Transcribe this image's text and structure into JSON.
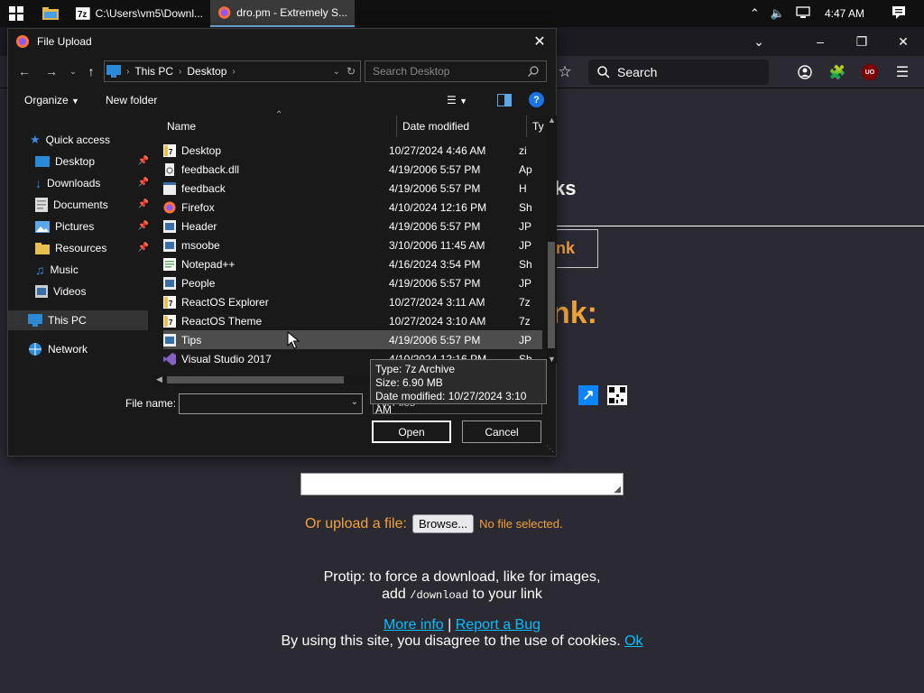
{
  "taskbar": {
    "tasks": [
      {
        "label": "C:\\Users\\vm5\\Downl...",
        "icon": "7zip-icon"
      },
      {
        "label": "dro.pm - Extremely S...",
        "icon": "firefox-icon"
      }
    ],
    "clock": "4:47 AM"
  },
  "firefox": {
    "search_placeholder": "Search",
    "ublock_badge": "UO"
  },
  "page": {
    "heading_frag_1": "ks",
    "heading_frag_2": "nk:",
    "link_box_text": "nk",
    "upload_label": "Or upload a file:",
    "browse_button": "Browse...",
    "no_file": "No file selected.",
    "protip_line1": "Protip: to force a download, like for images,",
    "protip_line2_pre": "add",
    "protip_code": "/download",
    "protip_line2_post": "to your link",
    "more_info": "More info",
    "separator": "|",
    "report_bug": "Report a Bug",
    "cookie_text": "By using this site, you disagree to the use of cookies.",
    "cookie_ok": "Ok"
  },
  "dialog": {
    "title": "File Upload",
    "breadcrumb": [
      "This PC",
      "Desktop"
    ],
    "search_placeholder": "Search Desktop",
    "organize": "Organize",
    "new_folder": "New folder",
    "nav": {
      "quick_access": "Quick access",
      "items": [
        {
          "label": "Desktop",
          "pinned": true
        },
        {
          "label": "Downloads",
          "pinned": true
        },
        {
          "label": "Documents",
          "pinned": true
        },
        {
          "label": "Pictures",
          "pinned": true
        },
        {
          "label": "Resources",
          "pinned": true
        },
        {
          "label": "Music",
          "pinned": false
        },
        {
          "label": "Videos",
          "pinned": false
        }
      ],
      "this_pc": "This PC",
      "network": "Network"
    },
    "columns": {
      "name": "Name",
      "date": "Date modified",
      "type": "Ty"
    },
    "files": [
      {
        "name": "Desktop",
        "date": "10/27/2024 4:46 AM",
        "type": "zi",
        "icon": "7z-archive-icon"
      },
      {
        "name": "feedback.dll",
        "date": "4/19/2006 5:57 PM",
        "type": "Ap",
        "icon": "dll-file-icon"
      },
      {
        "name": "feedback",
        "date": "4/19/2006 5:57 PM",
        "type": "H",
        "icon": "html-file-icon"
      },
      {
        "name": "Firefox",
        "date": "4/10/2024 12:16 PM",
        "type": "Sh",
        "icon": "firefox-shortcut-icon"
      },
      {
        "name": "Header",
        "date": "4/19/2006 5:57 PM",
        "type": "JP",
        "icon": "image-file-icon"
      },
      {
        "name": "msoobe",
        "date": "3/10/2006 11:45 AM",
        "type": "JP",
        "icon": "image-file-icon"
      },
      {
        "name": "Notepad++",
        "date": "4/16/2024 3:54 PM",
        "type": "Sh",
        "icon": "notepad-shortcut-icon"
      },
      {
        "name": "People",
        "date": "4/19/2006 5:57 PM",
        "type": "JP",
        "icon": "image-file-icon"
      },
      {
        "name": "ReactOS Explorer",
        "date": "10/27/2024 3:11 AM",
        "type": "7z",
        "icon": "7z-archive-icon"
      },
      {
        "name": "ReactOS Theme",
        "date": "10/27/2024 3:10 AM",
        "type": "7z",
        "icon": "7z-archive-icon"
      },
      {
        "name": "Tips",
        "date": "4/19/2006 5:57 PM",
        "type": "JP",
        "icon": "image-file-icon"
      },
      {
        "name": "Visual Studio 2017",
        "date": "4/10/2024 12:16 PM",
        "type": "Sh",
        "icon": "visual-studio-icon"
      }
    ],
    "file_name_label": "File name:",
    "file_name_value": "",
    "filter": "All Files",
    "open": "Open",
    "cancel": "Cancel",
    "tooltip": {
      "type": "Type: 7z Archive",
      "size": "Size: 6.90 MB",
      "modified": "Date modified: 10/27/2024 3:10 AM"
    }
  },
  "colors": {
    "accent_orange": "#f0a23a",
    "link_blue": "#00bfff",
    "page_bg": "#2b2a33",
    "dialog_bg": "#191919"
  }
}
